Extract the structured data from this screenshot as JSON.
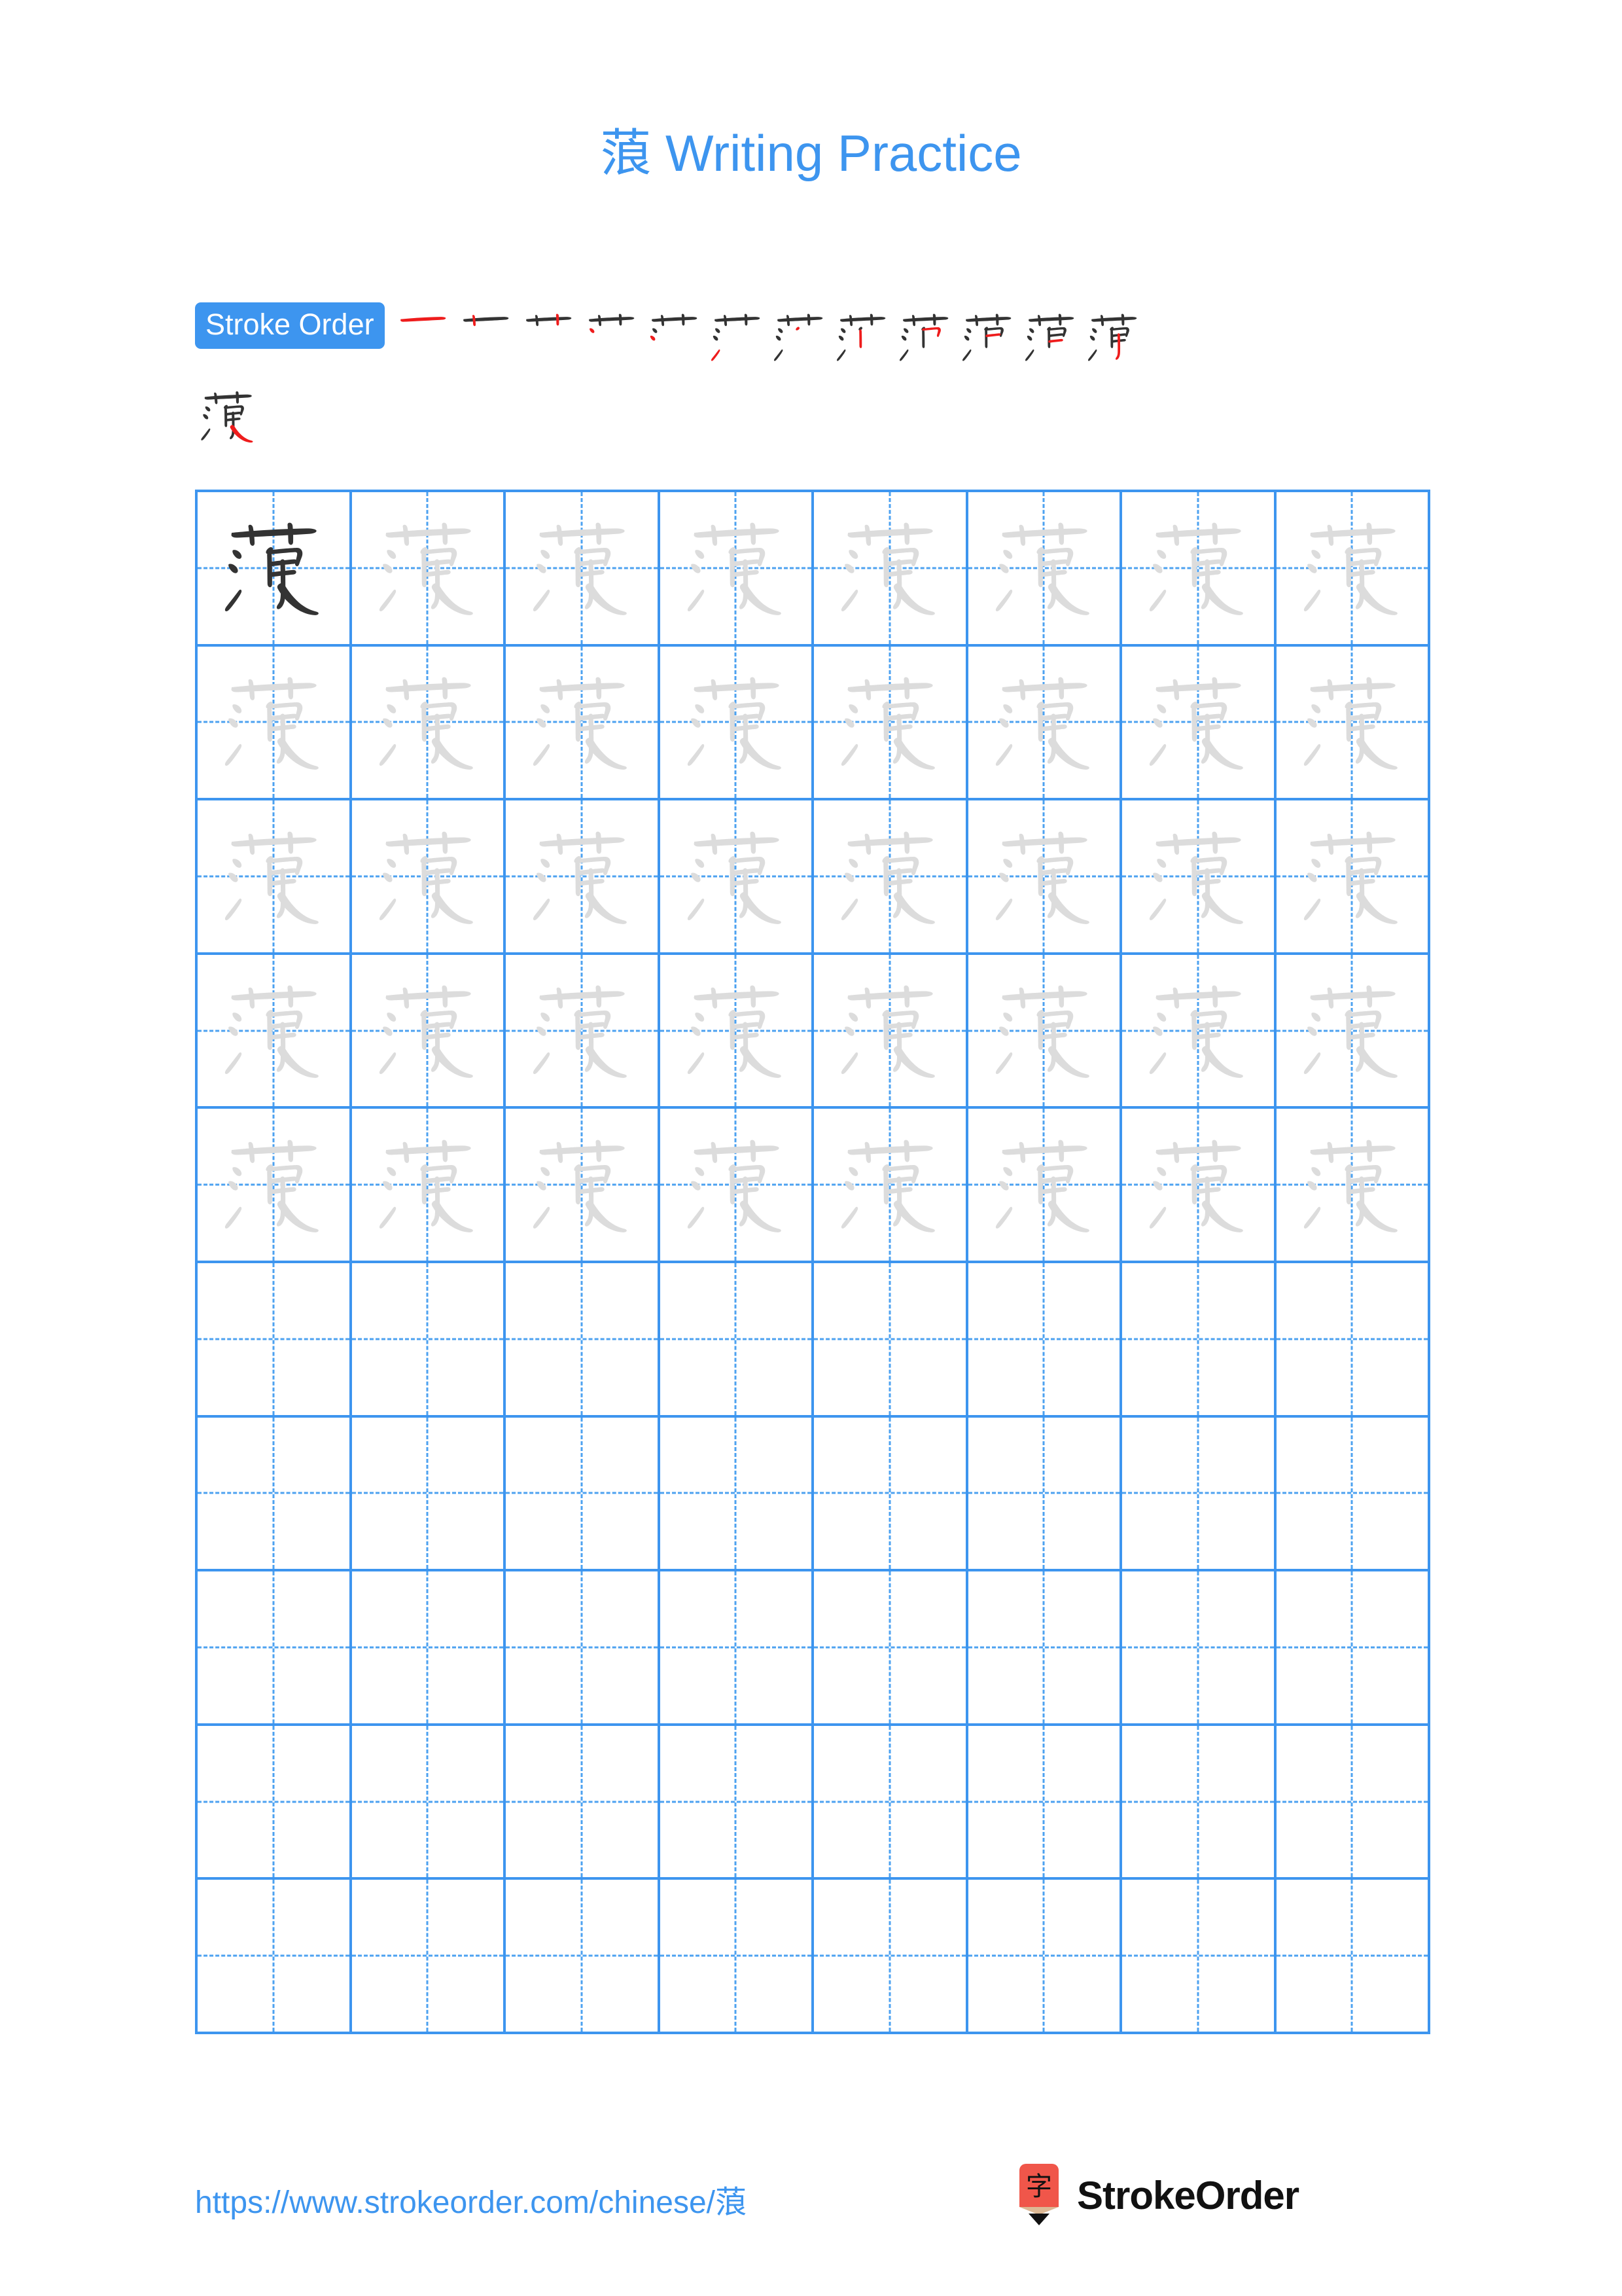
{
  "page": {
    "title": "蒗 Writing Practice",
    "character": "蒗",
    "background_color": "#ffffff",
    "accent_color": "#3d95ef",
    "grid_line_color": "#3d95ef",
    "model_char_color": "#333333",
    "trace_char_color": "#dcdcdc",
    "new_stroke_color": "#ee1c1c",
    "existing_stroke_color": "#333333"
  },
  "stroke_order": {
    "badge_label": "Stroke Order",
    "total_strokes": 13,
    "steps_row_1": [
      1,
      2,
      3,
      4,
      5,
      6,
      7,
      8,
      9,
      10,
      11,
      12
    ],
    "steps_row_2": [
      13
    ]
  },
  "practice_grid": {
    "columns": 8,
    "rows": 10,
    "model_cells": 1,
    "trace_cells": 39,
    "blank_cells": 40,
    "rows_detail": [
      {
        "row": 1,
        "cells": [
          "model",
          "trace",
          "trace",
          "trace",
          "trace",
          "trace",
          "trace",
          "trace"
        ]
      },
      {
        "row": 2,
        "cells": [
          "trace",
          "trace",
          "trace",
          "trace",
          "trace",
          "trace",
          "trace",
          "trace"
        ]
      },
      {
        "row": 3,
        "cells": [
          "trace",
          "trace",
          "trace",
          "trace",
          "trace",
          "trace",
          "trace",
          "trace"
        ]
      },
      {
        "row": 4,
        "cells": [
          "trace",
          "trace",
          "trace",
          "trace",
          "trace",
          "trace",
          "trace",
          "trace"
        ]
      },
      {
        "row": 5,
        "cells": [
          "trace",
          "trace",
          "trace",
          "trace",
          "trace",
          "trace",
          "trace",
          "trace"
        ]
      },
      {
        "row": 6,
        "cells": [
          "blank",
          "blank",
          "blank",
          "blank",
          "blank",
          "blank",
          "blank",
          "blank"
        ]
      },
      {
        "row": 7,
        "cells": [
          "blank",
          "blank",
          "blank",
          "blank",
          "blank",
          "blank",
          "blank",
          "blank"
        ]
      },
      {
        "row": 8,
        "cells": [
          "blank",
          "blank",
          "blank",
          "blank",
          "blank",
          "blank",
          "blank",
          "blank"
        ]
      },
      {
        "row": 9,
        "cells": [
          "blank",
          "blank",
          "blank",
          "blank",
          "blank",
          "blank",
          "blank",
          "blank"
        ]
      },
      {
        "row": 10,
        "cells": [
          "blank",
          "blank",
          "blank",
          "blank",
          "blank",
          "blank",
          "blank",
          "blank"
        ]
      }
    ]
  },
  "footer": {
    "url": "https://www.strokeorder.com/chinese/蒗",
    "brand_name": "StrokeOrder",
    "logo_char": "字",
    "logo_body_color": "#f0564a",
    "logo_wood_color": "#dcb894",
    "logo_tip_color": "#111111"
  }
}
